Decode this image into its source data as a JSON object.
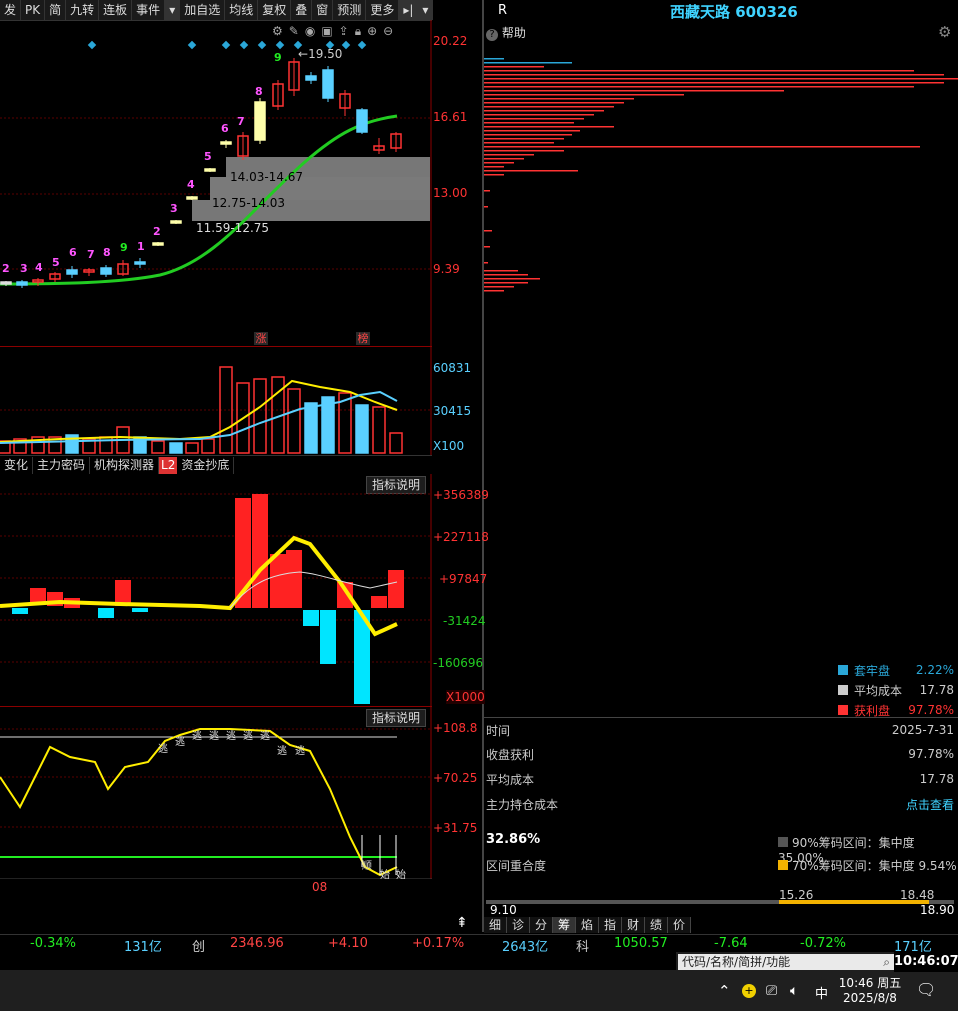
{
  "toolbar": {
    "items": [
      "发",
      "PK",
      "简",
      "九转",
      "连板",
      "事件",
      "▾",
      "加自选",
      "均线",
      "复权",
      "叠",
      "窗",
      "预测",
      "更多",
      "▸|",
      "▾"
    ]
  },
  "stock": {
    "title": "西藏天路 600326",
    "r_label": "R",
    "help": "帮助"
  },
  "main_chart": {
    "price_axis": [
      "20.22",
      "16.61",
      "13.00",
      "9.39"
    ],
    "high_label": "19.50",
    "box_labels": [
      "14.03-14.67",
      "12.75-14.03",
      "11.59-12.75"
    ],
    "count_labels": [
      "2",
      "3",
      "4",
      "5",
      "6",
      "7",
      "8",
      "9",
      "1",
      "2",
      "3",
      "4",
      "5",
      "6",
      "7",
      "8",
      "9"
    ],
    "events": [
      "涨",
      "榜"
    ]
  },
  "volume_panel": {
    "axis": [
      "60831",
      "30415",
      "X100"
    ]
  },
  "tabs": [
    "变化",
    "主力密码",
    "机构探测器",
    "L2",
    "资金抄底"
  ],
  "fund_panel": {
    "button": "指标说明",
    "axis": [
      "+356389",
      "+227118",
      "+97847",
      "-31424",
      "-160696",
      "X1000"
    ]
  },
  "osc_panel": {
    "button": "指标说明",
    "axis": [
      "+108.8",
      "+70.25",
      "+31.75"
    ],
    "month": "08",
    "markers": [
      "逃",
      "逃",
      "逃",
      "逃",
      "逃",
      "逃",
      "逃",
      "逃",
      "逃",
      "顺",
      "始",
      "始"
    ]
  },
  "chip": {
    "legend": [
      {
        "label": "套牢盘",
        "value": "2.22%",
        "color": "#2aa7d8"
      },
      {
        "label": "平均成本",
        "value": "17.78",
        "color": "#cccccc"
      },
      {
        "label": "获利盘",
        "value": "97.78%",
        "color": "#ff3333"
      }
    ],
    "time_label": "时间",
    "time_value": "2025-7-31",
    "profit_label": "收盘获利",
    "profit_value": "97.78%",
    "avg_label": "平均成本",
    "avg_value": "17.78",
    "main_cost_label": "主力持仓成本",
    "main_cost_link": "点击查看",
    "overlap_pct": "32.86%",
    "overlap_label": "区间重合度",
    "range90": "90%筹码区间：集中度35.00%",
    "range70": "70%筹码区间：集中度  9.54%",
    "bar_low": "15.26",
    "bar_high": "18.48",
    "scale_min": "9.10",
    "scale_max": "18.90",
    "bottom_tabs": [
      "细",
      "诊",
      "分",
      "筹",
      "焰",
      "指",
      "财",
      "绩",
      "价"
    ]
  },
  "ticker": {
    "items": [
      "-0.34%",
      "131亿",
      "创",
      "2346.96",
      "+4.10",
      "+0.17%",
      "2643亿",
      "科",
      "1050.57",
      "-7.64",
      "-0.72%",
      "171亿"
    ]
  },
  "taskbar": {
    "search_placeholder": "代码/名称/简拼/功能",
    "clock": "10:46:07",
    "time": "10:46 周五",
    "date": "2025/8/8",
    "ime": "中"
  }
}
